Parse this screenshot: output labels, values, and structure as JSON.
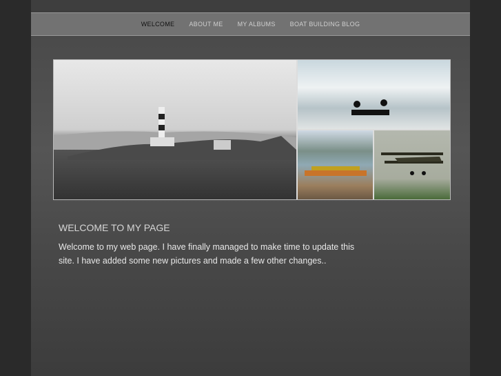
{
  "nav": {
    "items": [
      {
        "label": "WELCOME",
        "active": true
      },
      {
        "label": "ABOUT ME",
        "active": false
      },
      {
        "label": "MY ALBUMS",
        "active": false
      },
      {
        "label": "BOAT BUILDING BLOG",
        "active": false
      }
    ]
  },
  "content": {
    "heading": "WELCOME TO MY PAGE",
    "body": "Welcome to my web page. I have finally managed to make time to update this site. I have added some new pictures and made a few other changes.."
  }
}
